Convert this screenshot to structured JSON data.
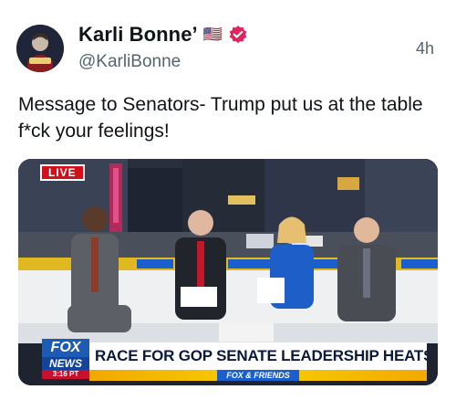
{
  "post": {
    "display_name": "Karli Bonne’",
    "flag_emoji": "🇺🇸",
    "verified_icon": "verified-badge-icon",
    "handle": "@KarliBonne",
    "timestamp": "4h",
    "text": "Message to Senators- Trump put us at the table f*ck your feelings!"
  },
  "media": {
    "live_label": "LIVE",
    "network_logo_top": "FOX",
    "network_logo_bottom": "NEWS",
    "network_logo_time": "3:16 PT",
    "headline": "RACE FOR GOP SENATE LEADERSHIP HEATS UP",
    "show_label": "FOX & FRIENDS",
    "desk_label": "FOX&",
    "colors": {
      "live_red": "#d0101a",
      "fox_blue": "#1e5bb5",
      "ticker_yellow": "#f5c000"
    }
  }
}
